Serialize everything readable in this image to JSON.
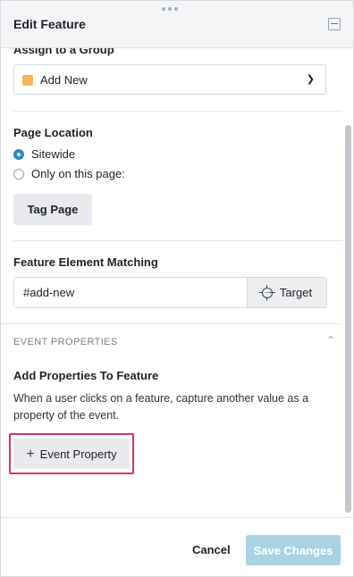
{
  "header": {
    "title": "Edit Feature"
  },
  "group": {
    "label": "Assign to a Group",
    "selected": "Add New",
    "swatch_color": "#f8b655"
  },
  "page_location": {
    "label": "Page Location",
    "options": [
      "Sitewide",
      "Only on this page:"
    ],
    "selected": "Sitewide",
    "tag_button": "Tag Page"
  },
  "element_matching": {
    "label": "Feature Element Matching",
    "value": "#add-new",
    "target_button": "Target"
  },
  "event_properties": {
    "section_title": "EVENT PROPERTIES",
    "heading": "Add Properties To Feature",
    "description": "When a user clicks on a feature, capture another value as a property of the event.",
    "add_button": "Event Property"
  },
  "footer": {
    "cancel": "Cancel",
    "save": "Save Changes"
  },
  "colors": {
    "accent": "#2a8bbd",
    "highlight": "#d6336c",
    "save_disabled": "#a9d3e3"
  }
}
